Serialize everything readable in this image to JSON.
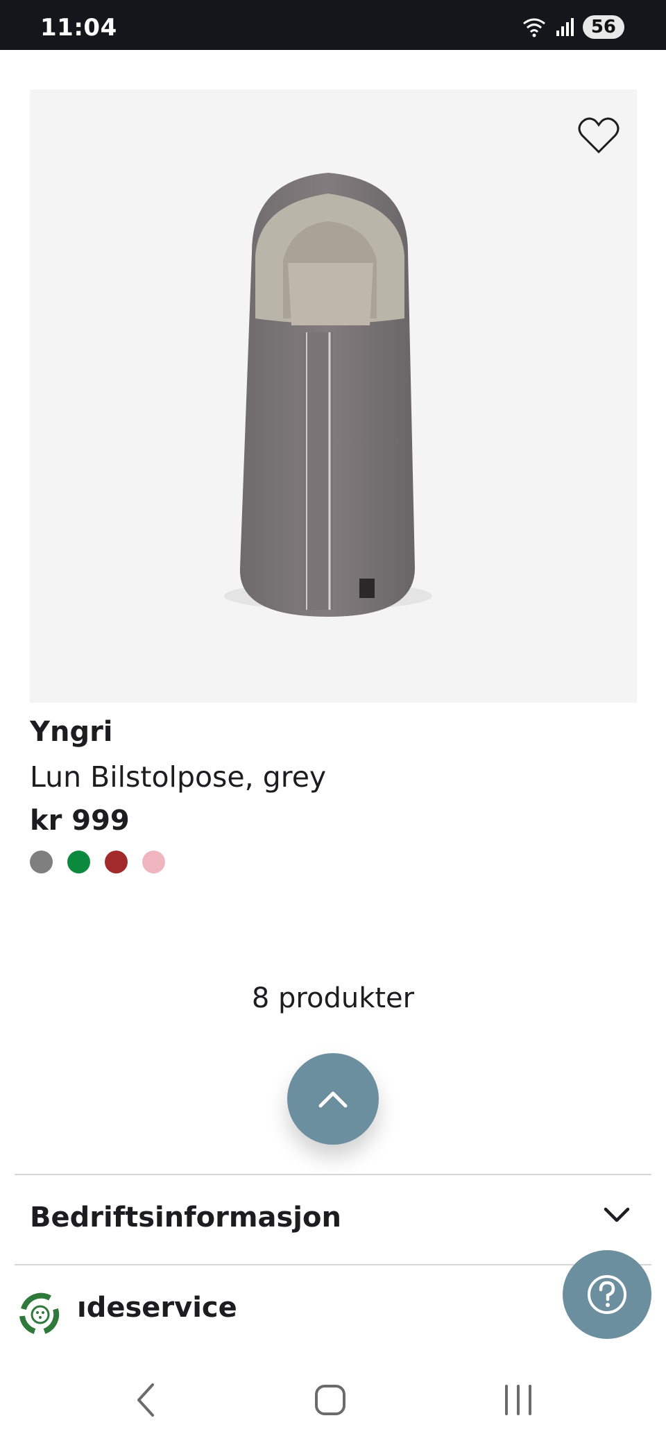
{
  "status_bar": {
    "time": "11:04",
    "battery": "56",
    "icons": [
      "wifi-icon",
      "signal-icon"
    ]
  },
  "product": {
    "brand": "Yngri",
    "name": "Lun Bilstolpose, grey",
    "price": "kr 999",
    "image": "grey-car-seat-footmuff",
    "swatches": [
      "#7f7f7f",
      "#0b8a3e",
      "#a32a2a",
      "#f0b6c0"
    ]
  },
  "list": {
    "count_label": "8 produkter"
  },
  "accordions": [
    {
      "label": "Bedriftsinformasjon"
    },
    {
      "label": "ıdeservice"
    }
  ],
  "colors": {
    "accent": "#6c8fa0",
    "eco_green": "#2f7a3a"
  },
  "icons": {
    "favorite": "heart-icon",
    "scroll_top": "chevron-up-icon",
    "help": "question-icon",
    "eco": "recycle-icon"
  }
}
